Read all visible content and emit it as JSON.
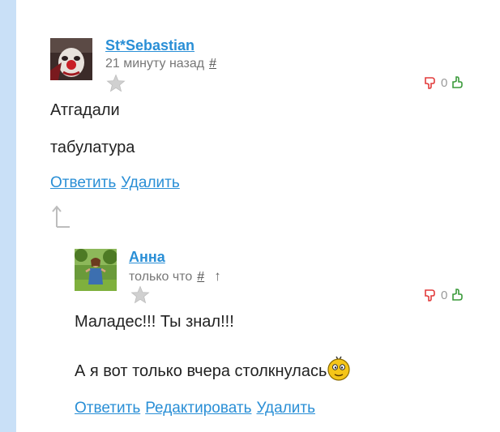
{
  "comments": [
    {
      "author": "St*Sebastian",
      "time": "21 минуту назад",
      "permalink": "#",
      "vote_count": "0",
      "lines": [
        "Атгадали",
        "табулатура"
      ],
      "actions": [
        "Ответить",
        "Удалить"
      ]
    },
    {
      "author": "Анна",
      "time": "только что",
      "permalink": "#",
      "parent_link": "↑",
      "vote_count": "0",
      "lines": [
        "Маладес!!! Ты знал!!!",
        "А я вот только вчера столкнулась"
      ],
      "actions": [
        "Ответить",
        "Редактировать",
        "Удалить"
      ]
    }
  ],
  "icons": {
    "rating_star": "star-icon",
    "vote_down": "thumbs-down-icon",
    "vote_up": "thumbs-up-icon",
    "go_to_parent": "arrow-up-icon",
    "emoticon": "smiley-emoticon"
  },
  "colors": {
    "link": "#2a8fd6",
    "sidebar": "#c9e0f7",
    "vote_down": "#e23b3b",
    "vote_up": "#3a9a3a",
    "star": "#d0d0d0"
  }
}
